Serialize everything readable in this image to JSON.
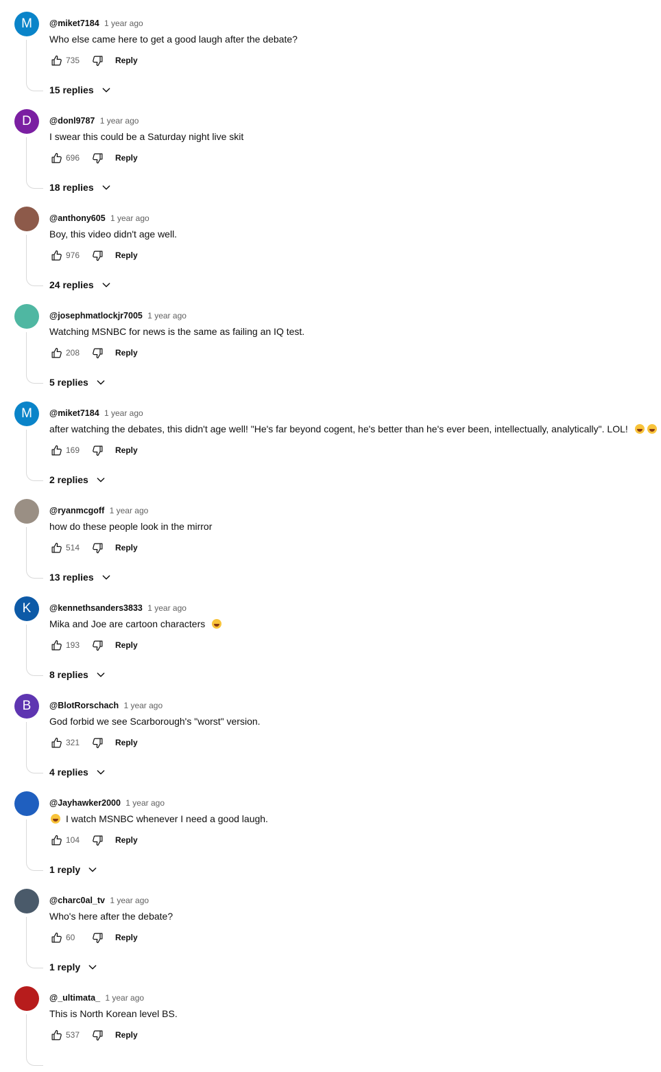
{
  "ui": {
    "reply_label": "Reply"
  },
  "comments": [
    {
      "author": "@miket7184",
      "time": "1 year ago",
      "text": "Who else came here to get a good laugh after the debate?",
      "likes": "735",
      "replies": "15 replies",
      "avatar": {
        "letter": "M",
        "color": "#0a84c9"
      }
    },
    {
      "author": "@donl9787",
      "time": "1 year ago",
      "text": "I swear this could be a Saturday night live skit",
      "likes": "696",
      "replies": "18 replies",
      "avatar": {
        "letter": "D",
        "color": "#7b1fa2"
      }
    },
    {
      "author": "@anthony605",
      "time": "1 year ago",
      "text": "Boy, this video didn't age well.",
      "likes": "976",
      "replies": "24 replies",
      "avatar": {
        "letter": "",
        "color": "#8d5a4a"
      }
    },
    {
      "author": "@josephmatlockjr7005",
      "time": "1 year ago",
      "text": "Watching MSNBC for news is the same as failing an IQ test.",
      "likes": "208",
      "replies": "5 replies",
      "avatar": {
        "letter": "",
        "color": "#4fb7a2"
      }
    },
    {
      "author": "@miket7184",
      "time": "1 year ago",
      "text": "after watching the debates, this didn't age well!  \"He's far beyond cogent, he's better than he's ever been, intellectually, analytically\".   LOL!",
      "emoji_after": 2,
      "likes": "169",
      "replies": "2 replies",
      "avatar": {
        "letter": "M",
        "color": "#0a84c9"
      }
    },
    {
      "author": "@ryanmcgoff",
      "time": "1 year ago",
      "text": "how do these people look in the mirror",
      "likes": "514",
      "replies": "13 replies",
      "avatar": {
        "letter": "",
        "color": "#9a8f84"
      }
    },
    {
      "author": "@kennethsanders3833",
      "time": "1 year ago",
      "text": "Mika and Joe are cartoon characters",
      "emoji_after": 1,
      "likes": "193",
      "replies": "8 replies",
      "avatar": {
        "letter": "K",
        "color": "#0d5aa7"
      }
    },
    {
      "author": "@BlotRorschach",
      "time": "1 year ago",
      "text": "God forbid we see Scarborough's \"worst\" version.",
      "likes": "321",
      "replies": "4 replies",
      "avatar": {
        "letter": "B",
        "color": "#5e35b1"
      }
    },
    {
      "author": "@Jayhawker2000",
      "time": "1 year ago",
      "text": "I watch MSNBC whenever I need a good laugh.",
      "emoji_before": 1,
      "likes": "104",
      "replies": "1 reply",
      "avatar": {
        "letter": "",
        "color": "#1f5fbf"
      }
    },
    {
      "author": "@charc0al_tv",
      "time": "1 year ago",
      "text": "Who's here after the debate?",
      "likes": "60",
      "replies": "1 reply",
      "avatar": {
        "letter": "",
        "color": "#4a5a6a"
      }
    },
    {
      "author": "@_ultimata_",
      "time": "1 year ago",
      "text": "This is North Korean level BS.",
      "likes": "537",
      "replies": "",
      "avatar": {
        "letter": "",
        "color": "#b71c1c"
      }
    }
  ]
}
